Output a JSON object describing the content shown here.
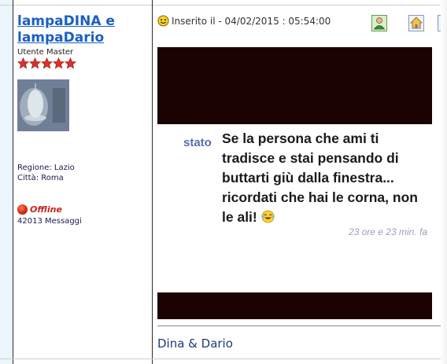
{
  "author": {
    "name_line1": "lampaDINA e",
    "name_line2": "lampaDario",
    "rank": "Utente Master",
    "stars": 5,
    "region": "Regione: Lazio",
    "city": "Città: Roma",
    "status": "Offline",
    "messages": "42013 Messaggi",
    "star_color": "#e0302a"
  },
  "post": {
    "date_label": "Inserito il - 04/02/2015 :  05:54:00",
    "icons": [
      "smiley-icon",
      "profile-icon",
      "home-icon"
    ],
    "image": {
      "stato": "stato",
      "text": "Se la persona che ami ti tradisce e stai pensando di buttarti giù dalla finestra... ricordati che hai le corna, non le ali!",
      "time": "23 ore e 23 min. fa",
      "background": "#1c0303"
    },
    "signature": "Dina & Dario"
  }
}
